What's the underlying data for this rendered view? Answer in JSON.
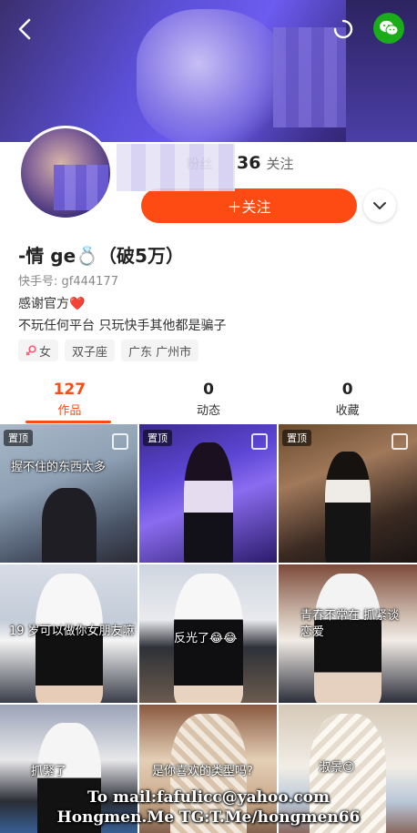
{
  "header": {
    "back_icon": "chevron-left-icon",
    "share_icon": "wechat-icon",
    "accent": "#fe4b13",
    "wechat_color": "#1aad19"
  },
  "profile": {
    "fans_label": "粉丝",
    "following_count": "36",
    "following_label": "关注",
    "follow_button": "＋关注",
    "nickname": "-情 ge💍（破5万）",
    "kuaishou_id": "快手号: gf444177",
    "bio_line1": "感谢官方❤️",
    "bio_line2": "不玩任何平台 只玩快手其他都是骗子",
    "tags": [
      {
        "icon": "female-icon",
        "label": "女"
      },
      {
        "icon": "",
        "label": "双子座"
      },
      {
        "icon": "",
        "label": "广东 广州市"
      }
    ]
  },
  "tabs": [
    {
      "count": "127",
      "label": "作品",
      "active": true
    },
    {
      "count": "0",
      "label": "动态",
      "active": false
    },
    {
      "count": "0",
      "label": "收藏",
      "active": false
    }
  ],
  "grid": [
    {
      "pinned": "置顶",
      "caption": "握不住的东西太多"
    },
    {
      "pinned": "置顶",
      "caption": ""
    },
    {
      "pinned": "置顶",
      "caption": ""
    },
    {
      "pinned": "",
      "caption": "19 岁可以做你女朋友嘛"
    },
    {
      "pinned": "",
      "caption": "反光了😂😂"
    },
    {
      "pinned": "",
      "caption": "青春不常在 抓紧谈恋爱"
    },
    {
      "pinned": "",
      "caption": "抓緊了"
    },
    {
      "pinned": "",
      "caption": "是你喜欢的类型吗?"
    },
    {
      "pinned": "",
      "caption": "淑景😊"
    }
  ],
  "watermark": {
    "line1": "To mail:fafulicc@yahoo.com",
    "line2": "Hongmen.Me TG:T.Me/hongmen66"
  }
}
